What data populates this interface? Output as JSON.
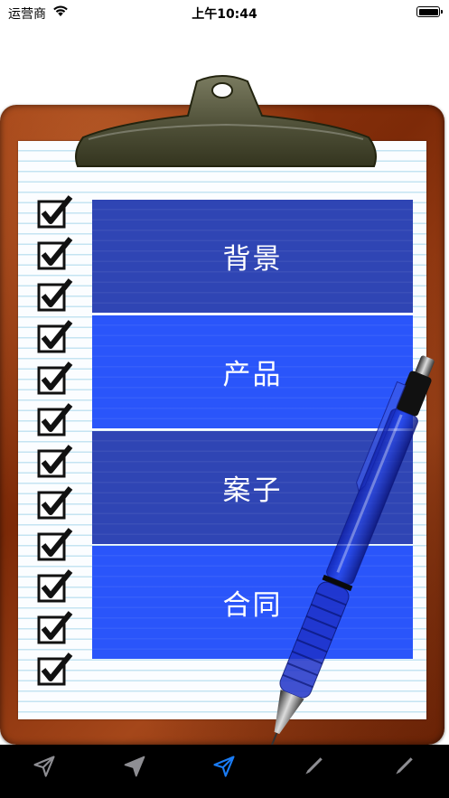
{
  "status_bar": {
    "carrier": "运营商",
    "time": "上午10:44"
  },
  "checkboxes": [
    "checked",
    "checked",
    "checked",
    "checked",
    "checked",
    "checked",
    "checked",
    "checked",
    "checked",
    "checked",
    "checked",
    "checked"
  ],
  "menu": {
    "items": [
      {
        "label": "背景",
        "color": "#2f45b4"
      },
      {
        "label": "产品",
        "color": "#2a55fa"
      },
      {
        "label": "案子",
        "color": "#2f45b4"
      },
      {
        "label": "合同",
        "color": "#2a55fa"
      }
    ]
  },
  "tab_bar": {
    "tabs": [
      {
        "icon": "send-outline-icon",
        "selected": false
      },
      {
        "icon": "send-filled-icon",
        "selected": false
      },
      {
        "icon": "send-outline-icon",
        "selected": true
      },
      {
        "icon": "pencil-icon",
        "selected": false
      },
      {
        "icon": "pencil-icon",
        "selected": false
      }
    ],
    "selected_color": "#1a7cf5",
    "unselected_color": "#8e8e93"
  }
}
